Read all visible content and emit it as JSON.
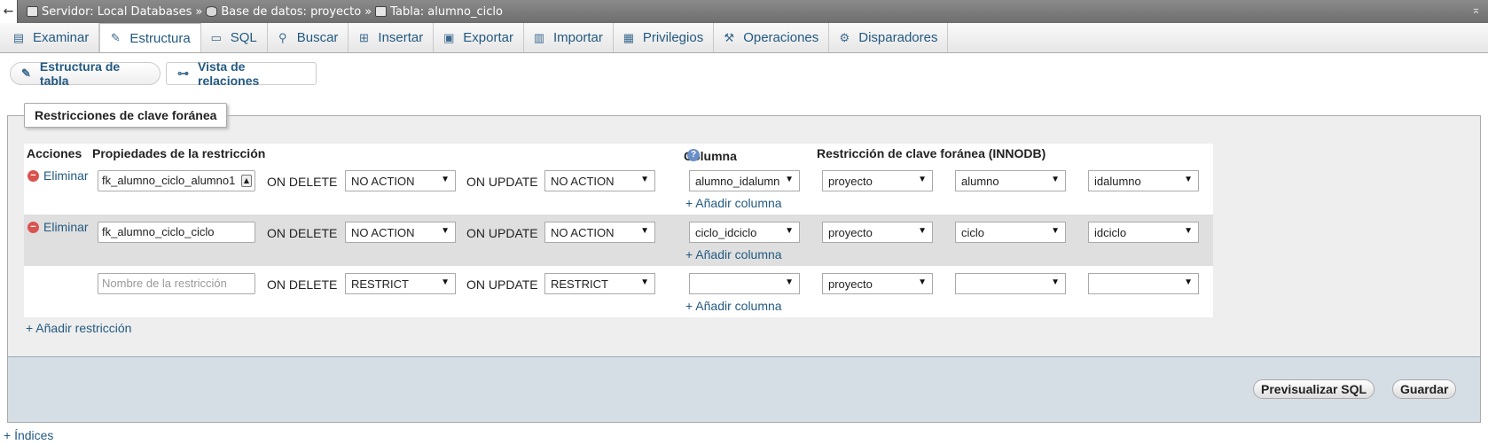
{
  "breadcrumb": {
    "server": "Servidor: Local Databases",
    "database": "Base de datos: proyecto",
    "table": "Tabla: alumno_ciclo",
    "sep": "»"
  },
  "tabs": [
    {
      "label": "Examinar",
      "icon": "browse-icon"
    },
    {
      "label": "Estructura",
      "icon": "structure-icon"
    },
    {
      "label": "SQL",
      "icon": "sql-icon"
    },
    {
      "label": "Buscar",
      "icon": "search-icon"
    },
    {
      "label": "Insertar",
      "icon": "insert-icon"
    },
    {
      "label": "Exportar",
      "icon": "export-icon"
    },
    {
      "label": "Importar",
      "icon": "import-icon"
    },
    {
      "label": "Privilegios",
      "icon": "privileges-icon"
    },
    {
      "label": "Operaciones",
      "icon": "wrench-icon"
    },
    {
      "label": "Disparadores",
      "icon": "triggers-icon"
    }
  ],
  "subnav": {
    "structure_label": "Estructura de tabla",
    "relations_label": "Vista de relaciones"
  },
  "legend": "Restricciones de clave foránea",
  "headers": {
    "actions": "Acciones",
    "properties": "Propiedades de la restricción",
    "column": "Columna",
    "fk": "Restricción de clave foránea (INNODB)"
  },
  "rows": [
    {
      "delete_label": "Eliminar",
      "name": "fk_alumno_ciclo_alumno1",
      "on_delete_label": "ON DELETE",
      "on_delete": "NO ACTION",
      "on_update_label": "ON UPDATE",
      "on_update": "NO ACTION",
      "column": "alumno_idalumn",
      "ref_db": "proyecto",
      "ref_table": "alumno",
      "ref_column": "idalumno",
      "add_column": "+ Añadir columna"
    },
    {
      "delete_label": "Eliminar",
      "name": "fk_alumno_ciclo_ciclo",
      "on_delete_label": "ON DELETE",
      "on_delete": "NO ACTION",
      "on_update_label": "ON UPDATE",
      "on_update": "NO ACTION",
      "column": "ciclo_idciclo",
      "ref_db": "proyecto",
      "ref_table": "ciclo",
      "ref_column": "idciclo",
      "add_column": "+ Añadir columna"
    },
    {
      "name_placeholder": "Nombre de la restricción",
      "on_delete_label": "ON DELETE",
      "on_delete": "RESTRICT",
      "on_update_label": "ON UPDATE",
      "on_update": "RESTRICT",
      "column": "",
      "ref_db": "proyecto",
      "ref_table": "",
      "ref_column": "",
      "add_column": "+ Añadir columna"
    }
  ],
  "add_restriction": "+ Añadir restricción",
  "buttons": {
    "preview_sql": "Previsualizar SQL",
    "save": "Guardar"
  },
  "indices_link": "+ Índices",
  "arrow_glyph": "▼"
}
